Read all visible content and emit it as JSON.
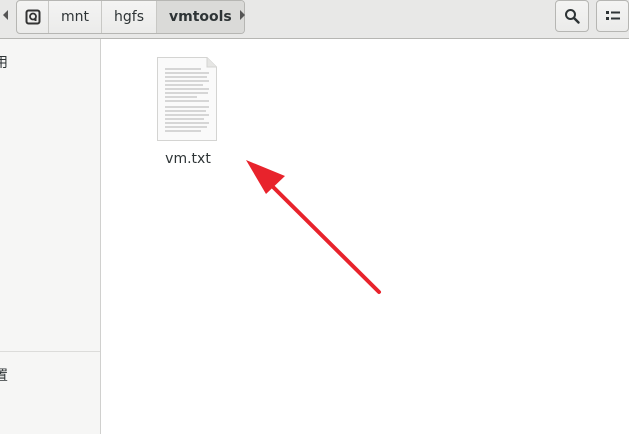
{
  "headerbar": {
    "path": [
      "mnt",
      "hgfs",
      "vmtools"
    ],
    "active": "vmtools",
    "icons": {
      "back": "chevron-left-icon",
      "forward": "chevron-right-icon",
      "root": "drive-icon",
      "search": "search-icon",
      "view": "view-list-icon"
    }
  },
  "sidebar": {
    "items": [
      {
        "label": "用"
      },
      {
        "label": "置"
      }
    ]
  },
  "files": [
    {
      "name": "vm.txt",
      "icon": "text-document-icon"
    }
  ],
  "annotation": {
    "color": "#e8232c",
    "icon": "red-arrow-annotation"
  }
}
